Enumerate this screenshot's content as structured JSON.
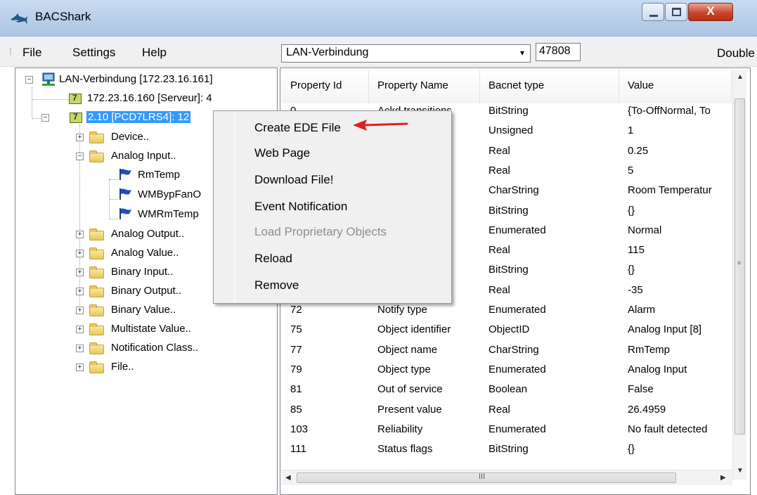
{
  "window": {
    "title": "BACShark",
    "controls": {
      "close_label": "X"
    }
  },
  "menubar": {
    "items": [
      "File",
      "Settings",
      "Help"
    ],
    "connection_select": {
      "value": "LAN-Verbindung",
      "arrow": "▾"
    },
    "port": "47808",
    "right_label": "Double"
  },
  "tree": {
    "root": "LAN-Verbindung [172.23.16.161]",
    "devices": [
      "172.23.16.160 [Serveur]: 4",
      "2.10 [PCD7LRS4]: 12"
    ],
    "folders": [
      {
        "label": "Device..",
        "expanded": false
      },
      {
        "label": "Analog Input..",
        "expanded": true,
        "children": [
          "RmTemp",
          "WMBypFanO",
          "WMRmTemp"
        ]
      },
      {
        "label": "Analog Output..",
        "expanded": false
      },
      {
        "label": "Analog Value..",
        "expanded": false
      },
      {
        "label": "Binary Input..",
        "expanded": false
      },
      {
        "label": "Binary Output..",
        "expanded": false
      },
      {
        "label": "Binary Value..",
        "expanded": false
      },
      {
        "label": "Multistate Value..",
        "expanded": false
      },
      {
        "label": "Notification Class..",
        "expanded": false
      },
      {
        "label": "File..",
        "expanded": false
      }
    ]
  },
  "table": {
    "columns": [
      "Property Id",
      "Property Name",
      "Bacnet type",
      "Value"
    ],
    "rows": [
      [
        "0",
        "Ackd transitions",
        "BitString",
        "{To-OffNormal, To"
      ],
      [
        "",
        "ass",
        "Unsigned",
        "1"
      ],
      [
        "",
        "t",
        "Real",
        "0.25"
      ],
      [
        "",
        "",
        "Real",
        "5"
      ],
      [
        "",
        "",
        "CharString",
        "Room Temperatur"
      ],
      [
        "",
        "",
        "BitString",
        "{}"
      ],
      [
        "",
        "",
        "Enumerated",
        "Normal"
      ],
      [
        "",
        "",
        "Real",
        "115"
      ],
      [
        "",
        "",
        "BitString",
        "{}"
      ],
      [
        "",
        "",
        "Real",
        "-35"
      ],
      [
        "72",
        "Notify type",
        "Enumerated",
        "Alarm"
      ],
      [
        "75",
        "Object identifier",
        "ObjectID",
        "Analog Input [8]"
      ],
      [
        "77",
        "Object name",
        "CharString",
        "RmTemp"
      ],
      [
        "79",
        "Object type",
        "Enumerated",
        "Analog Input"
      ],
      [
        "81",
        "Out of service",
        "Boolean",
        "False"
      ],
      [
        "85",
        "Present value",
        "Real",
        "26.4959"
      ],
      [
        "103",
        "Reliability",
        "Enumerated",
        "No fault detected"
      ],
      [
        "111",
        "Status flags",
        "BitString",
        "{}"
      ]
    ],
    "hscroll_glyph": "III"
  },
  "context_menu": {
    "items": [
      {
        "label": "Create EDE File",
        "enabled": true
      },
      {
        "label": "Web Page",
        "enabled": true
      },
      {
        "label": "Download File!",
        "enabled": true
      },
      {
        "label": "Event Notification",
        "enabled": true
      },
      {
        "label": "Load Proprietary Objects",
        "enabled": false
      },
      {
        "label": "Reload",
        "enabled": true
      },
      {
        "label": "Remove",
        "enabled": true
      }
    ]
  },
  "colors": {
    "selection": "#3399ff",
    "annotation_arrow": "#e02020"
  },
  "icons": [
    "shark-icon",
    "network-icon",
    "device-icon",
    "folder-icon",
    "flag-icon"
  ]
}
